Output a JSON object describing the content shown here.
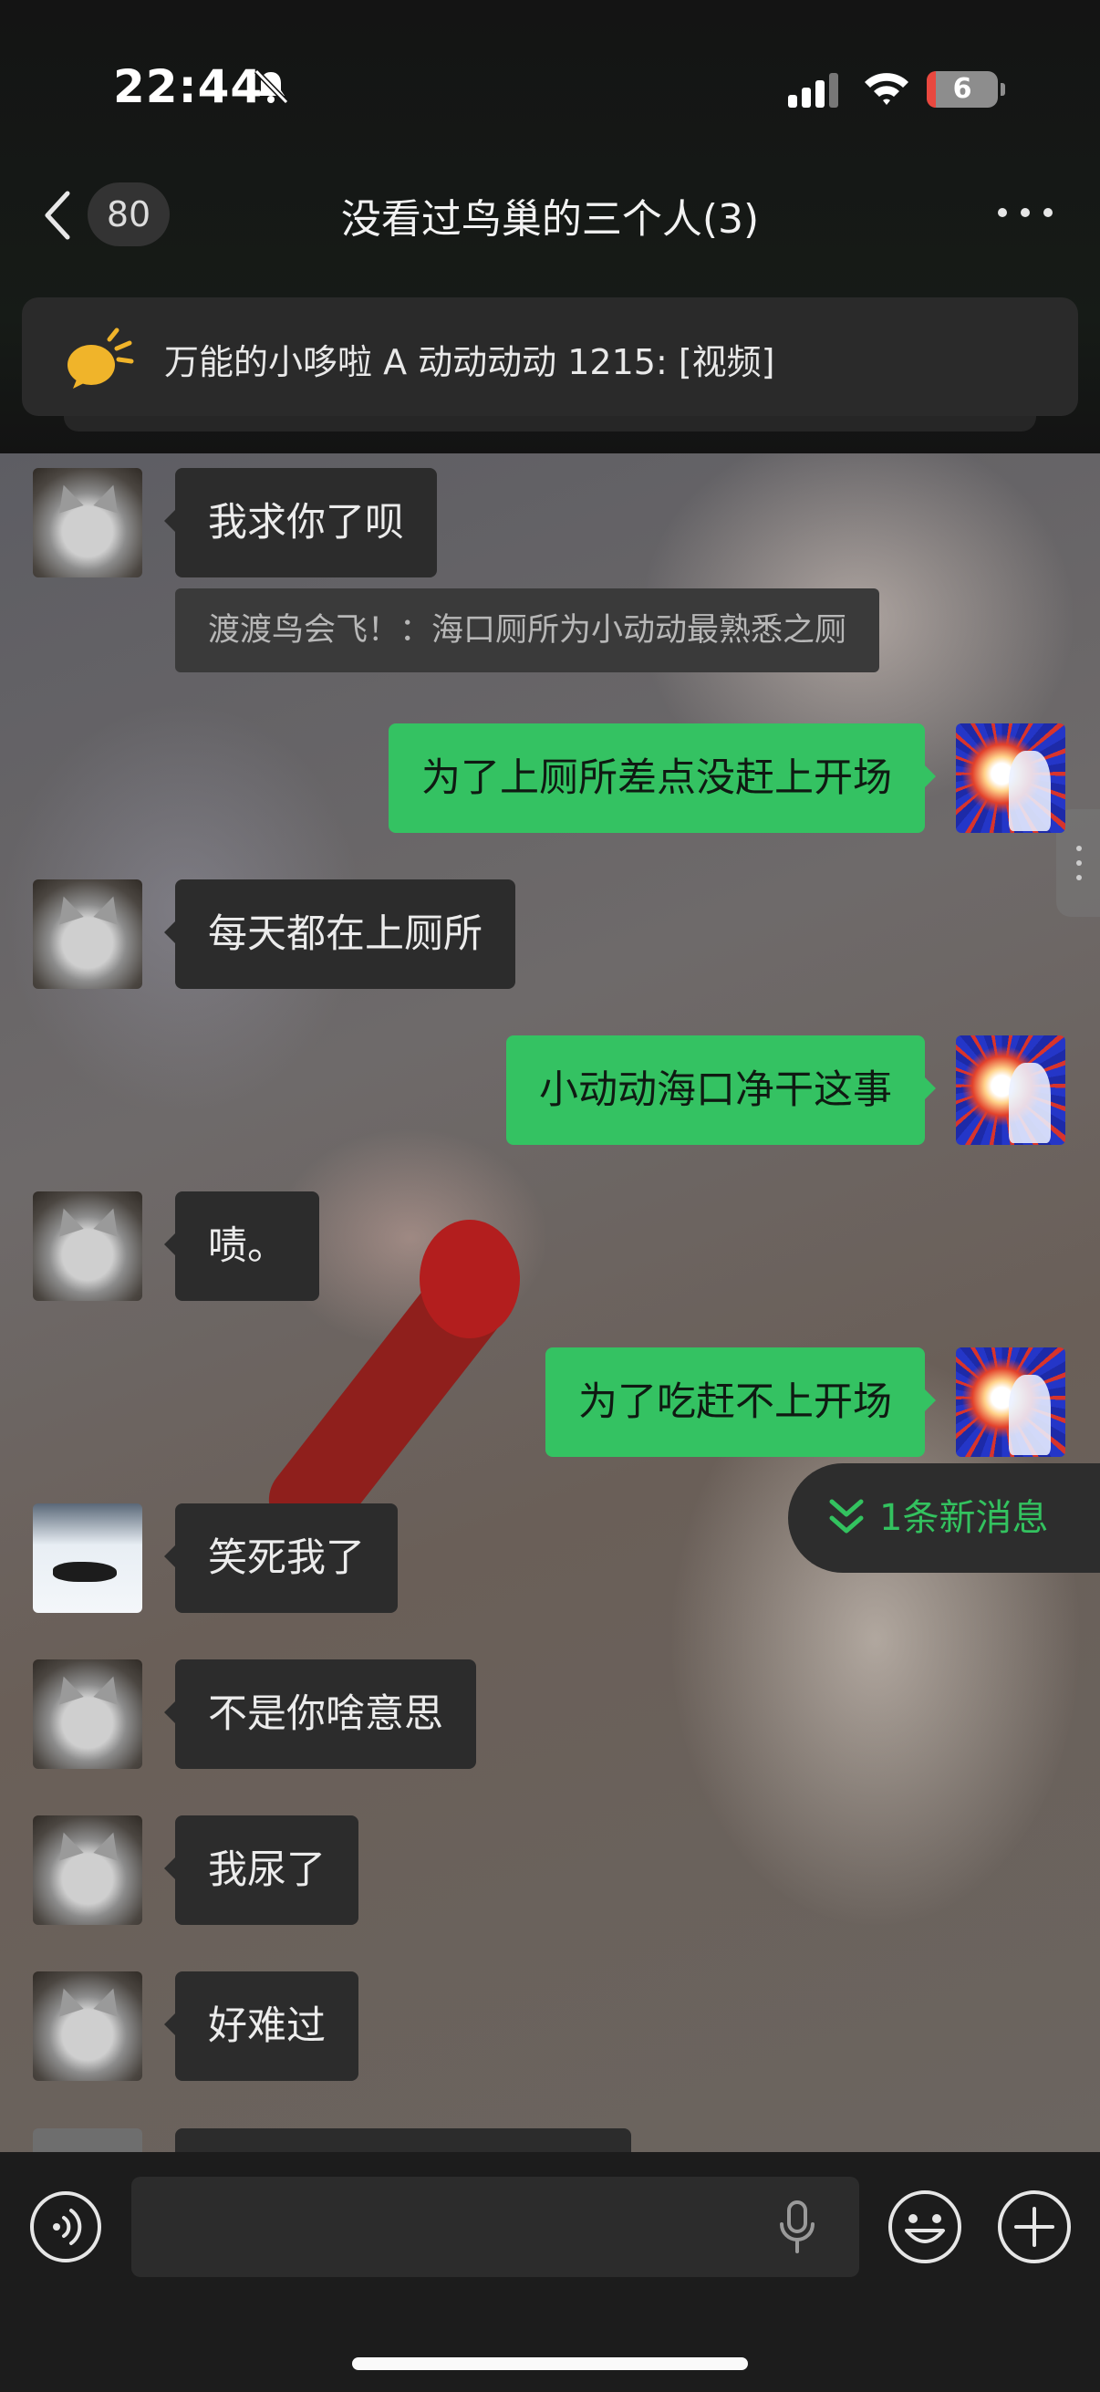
{
  "status_bar": {
    "time": "22:44",
    "battery": "6",
    "icons": [
      "bell-off-icon",
      "cellular-signal-icon",
      "wifi-icon",
      "battery-icon"
    ]
  },
  "nav": {
    "back_icon": "chevron-left-icon",
    "unread_count": "80",
    "title": "没看过鸟巢的三个人(3)",
    "more_icon": "more-dots-icon"
  },
  "pinned": {
    "icon": "speaker-announcement-icon",
    "text": "万能的小哆啦 A 动动动动 1215: [视频]"
  },
  "messages": [
    {
      "side": "in",
      "avatar": "cat-avatar",
      "text": "我求你了呗",
      "quote": "渡渡鸟会飞！：海口厕所为小动动最熟悉之厕"
    },
    {
      "side": "out",
      "avatar": "self-avatar",
      "text": "为了上厕所差点没赶上开场"
    },
    {
      "side": "in",
      "avatar": "cat-avatar",
      "text": "每天都在上厕所"
    },
    {
      "side": "out",
      "avatar": "self-avatar",
      "text": "小动动海口净干这事"
    },
    {
      "side": "in",
      "avatar": "cat-avatar",
      "text": "啧。"
    },
    {
      "side": "out",
      "avatar": "self-avatar",
      "text": "为了吃赶不上开场"
    },
    {
      "side": "in",
      "avatar": "cat-in-snow-avatar",
      "text": "笑死我了"
    },
    {
      "side": "in",
      "avatar": "cat-avatar",
      "text": "不是你啥意思"
    },
    {
      "side": "in",
      "avatar": "cat-avatar",
      "text": "我尿了"
    },
    {
      "side": "in",
      "avatar": "cat-avatar",
      "text": "好难过"
    }
  ],
  "new_messages": {
    "label": "1条新消息",
    "icon": "double-chevron-down-icon",
    "accent": "#33c25f"
  },
  "input_bar": {
    "icons": [
      "voice-icon",
      "microphone-icon",
      "emoji-icon",
      "plus-icon"
    ]
  },
  "colors": {
    "outgoing_bubble": "#34c262",
    "incoming_bubble": "#2c2c2c",
    "background": "#111111"
  }
}
